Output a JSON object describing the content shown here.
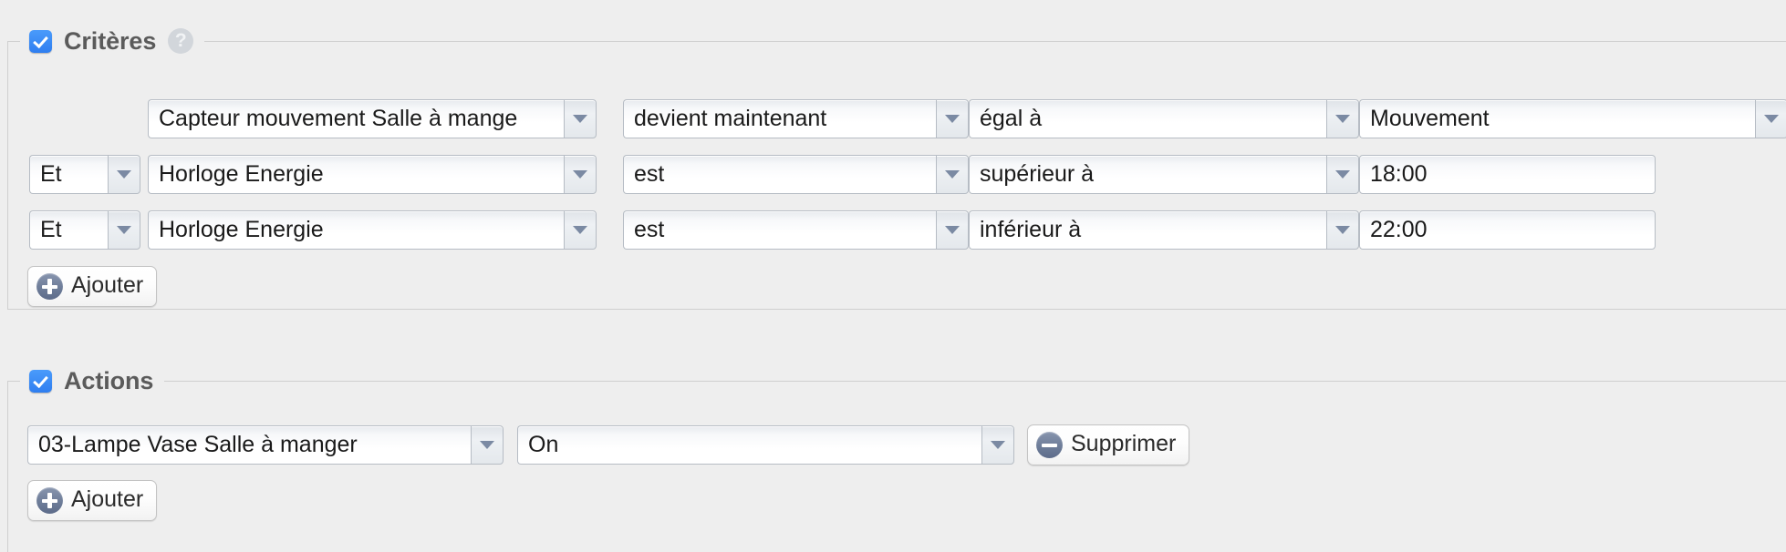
{
  "window": {
    "background_color": "#eeeeee"
  },
  "criteria_section": {
    "legend": "Critères",
    "checkbox_checked": true,
    "checkbox_color": "#3b86f0",
    "help_icon": "help-question-icon",
    "columns": [
      "conjunction",
      "source",
      "event",
      "operator",
      "value"
    ],
    "rows": [
      {
        "conjunction": "",
        "conjunction_visible": false,
        "source": "Capteur mouvement Salle à mange",
        "event": "devient maintenant",
        "operator": "égal à",
        "value": "Mouvement",
        "value_type": "select"
      },
      {
        "conjunction": "Et",
        "conjunction_visible": true,
        "source": "Horloge Energie",
        "event": "est",
        "operator": "supérieur à",
        "value": "18:00",
        "value_type": "text"
      },
      {
        "conjunction": "Et",
        "conjunction_visible": true,
        "source": "Horloge Energie",
        "event": "est",
        "operator": "inférieur à",
        "value": "22:00",
        "value_type": "text"
      }
    ],
    "add_button": {
      "label": "Ajouter",
      "icon": "plus-circle-icon"
    }
  },
  "actions_section": {
    "legend": "Actions",
    "checkbox_checked": true,
    "checkbox_color": "#3b86f0",
    "rows": [
      {
        "target": "03-Lampe Vase Salle à manger",
        "state": "On",
        "delete_button": {
          "label": "Supprimer",
          "icon": "minus-circle-icon"
        }
      }
    ],
    "add_button": {
      "label": "Ajouter",
      "icon": "plus-circle-icon"
    }
  }
}
